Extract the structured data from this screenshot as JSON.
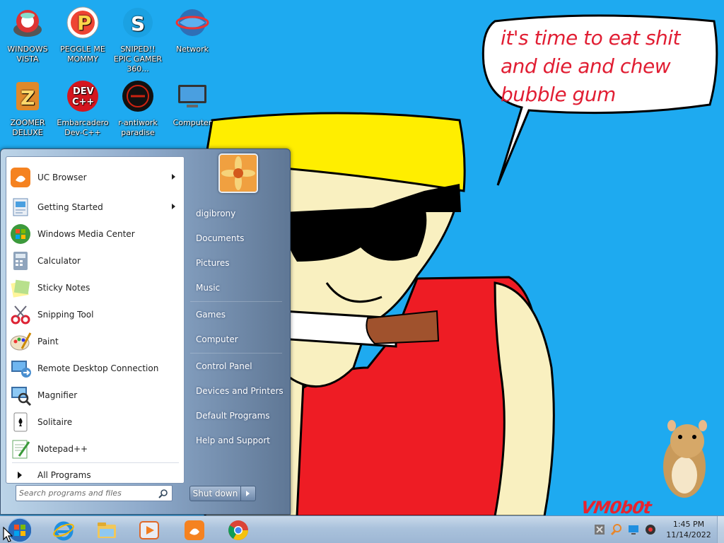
{
  "desktop": {
    "icons": [
      {
        "label": "WINDOWS VISTA",
        "icon": "windows-vista-icon"
      },
      {
        "label": "PEGGLE ME MOMMY",
        "icon": "peggle-icon"
      },
      {
        "label": "SNIPED!! EPIC GAMER 360...",
        "icon": "skype-icon"
      },
      {
        "label": "Network",
        "icon": "network-icon"
      },
      {
        "label": "ZOOMER DELUXE",
        "icon": "zoomer-icon"
      },
      {
        "label": "Embarcadero Dev-C++",
        "icon": "devcpp-icon"
      },
      {
        "label": "r-antiwork paradise",
        "icon": "antiwork-icon"
      },
      {
        "label": "Computer",
        "icon": "computer-icon"
      }
    ],
    "devcpp_text": [
      "DEV",
      "C++"
    ],
    "speech_bubble": [
      "it's time to eat shit",
      "and die and chew",
      "bubble gum"
    ],
    "signature": "VM0b0t"
  },
  "start_menu": {
    "programs": [
      {
        "label": "UC Browser",
        "icon": "uc-browser-icon",
        "submenu": true
      },
      {
        "label": "Getting Started",
        "icon": "getting-started-icon",
        "submenu": true
      },
      {
        "label": "Windows Media Center",
        "icon": "media-center-icon",
        "submenu": false
      },
      {
        "label": "Calculator",
        "icon": "calculator-icon",
        "submenu": false
      },
      {
        "label": "Sticky Notes",
        "icon": "sticky-notes-icon",
        "submenu": false
      },
      {
        "label": "Snipping Tool",
        "icon": "snipping-tool-icon",
        "submenu": false
      },
      {
        "label": "Paint",
        "icon": "paint-icon",
        "submenu": false
      },
      {
        "label": "Remote Desktop Connection",
        "icon": "remote-desktop-icon",
        "submenu": false
      },
      {
        "label": "Magnifier",
        "icon": "magnifier-icon",
        "submenu": false
      },
      {
        "label": "Solitaire",
        "icon": "solitaire-icon",
        "submenu": false
      },
      {
        "label": "Notepad++",
        "icon": "notepadpp-icon",
        "submenu": false
      }
    ],
    "all_programs": "All Programs",
    "search_placeholder": "Search programs and files",
    "right": {
      "user": "digibrony",
      "documents": "Documents",
      "pictures": "Pictures",
      "music": "Music",
      "games": "Games",
      "computer": "Computer",
      "control_panel": "Control Panel",
      "devices_printers": "Devices and Printers",
      "default_programs": "Default Programs",
      "help_support": "Help and Support"
    },
    "shutdown": "Shut down"
  },
  "taskbar": {
    "pinned": [
      "internet-explorer-icon",
      "windows-explorer-icon",
      "media-player-icon",
      "uc-browser-icon",
      "chrome-icon"
    ],
    "time": "1:45 PM",
    "date": "11/14/2022"
  },
  "colors": {
    "wallpaper": "#1eaaf0",
    "bubble_text": "#e11e33",
    "hat": "#ffee00",
    "shirt": "#ee1c24",
    "skin": "#f9f0c0"
  }
}
